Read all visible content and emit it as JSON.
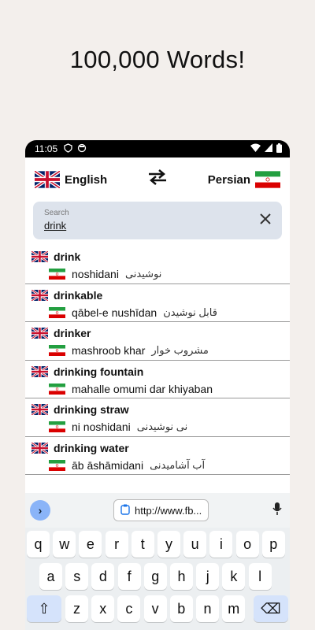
{
  "headline": "100,000 Words!",
  "status_bar": {
    "time": "11:05"
  },
  "languages": {
    "source": "English",
    "target": "Persian"
  },
  "search": {
    "placeholder": "Search",
    "value": "drink"
  },
  "results": [
    {
      "english": "drink",
      "translit": "noshidani",
      "persian": "نوشیدنی"
    },
    {
      "english": "drinkable",
      "translit": "qābel-e nushīdan",
      "persian": "قابل نوشیدن"
    },
    {
      "english": "drinker",
      "translit": "mashroob khar",
      "persian": "مشروب خوار"
    },
    {
      "english": "drinking fountain",
      "translit": "mahalle omumi dar khiyaban",
      "persian": ""
    },
    {
      "english": "drinking straw",
      "translit": "ni noshidani",
      "persian": "نی نوشیدنی"
    },
    {
      "english": "drinking water",
      "translit": "āb āshāmidani",
      "persian": "آب آشامیدنی"
    }
  ],
  "keyboard": {
    "url_chip": "http://www.fb...",
    "row1": [
      "q",
      "w",
      "e",
      "r",
      "t",
      "y",
      "u",
      "i",
      "o",
      "p"
    ],
    "row2": [
      "a",
      "s",
      "d",
      "f",
      "g",
      "h",
      "j",
      "k",
      "l"
    ],
    "row3": [
      "z",
      "x",
      "c",
      "v",
      "b",
      "n",
      "m"
    ]
  },
  "colors": {
    "search_bg": "#dde3ec",
    "page_bg": "#f3efec",
    "key_accent": "#8ab4f8"
  }
}
